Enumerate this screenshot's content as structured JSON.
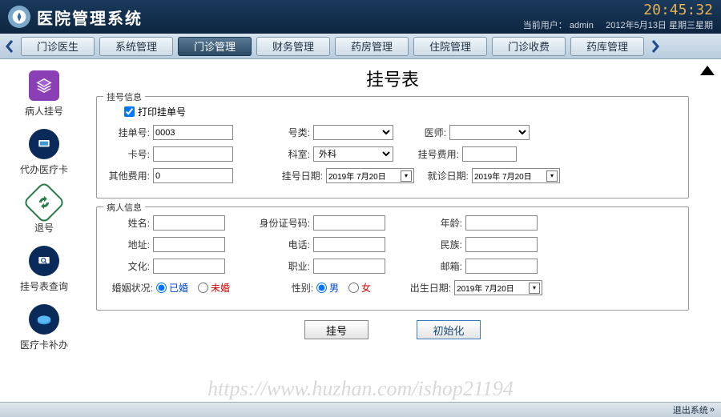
{
  "header": {
    "app_title": "医院管理系统",
    "clock": "20:45:32",
    "user_label": "当前用户：",
    "user_name": "admin",
    "date_text": "2012年5月13日  星期三星期"
  },
  "tabs": [
    {
      "label": "门诊医生",
      "active": false
    },
    {
      "label": "系统管理",
      "active": false
    },
    {
      "label": "门诊管理",
      "active": true
    },
    {
      "label": "财务管理",
      "active": false
    },
    {
      "label": "药房管理",
      "active": false
    },
    {
      "label": "住院管理",
      "active": false
    },
    {
      "label": "门诊收费",
      "active": false
    },
    {
      "label": "药库管理",
      "active": false
    }
  ],
  "sidebar": {
    "items": [
      {
        "label": "病人挂号",
        "icon": "layers-icon",
        "color": "#8a3fb5"
      },
      {
        "label": "代办医疗卡",
        "icon": "monitor-icon",
        "color": "#1a4a9a"
      },
      {
        "label": "退号",
        "icon": "refresh-icon",
        "color": "#2a7a4a"
      },
      {
        "label": "挂号表查询",
        "icon": "search-monitor-icon",
        "color": "#1a4a9a"
      },
      {
        "label": "医疗卡补办",
        "icon": "card-icon",
        "color": "#1a6aaa"
      }
    ]
  },
  "page": {
    "title": "挂号表"
  },
  "group1": {
    "title": "挂号信息",
    "print_chk": "打印挂单号",
    "reg_no_lbl": "挂单号:",
    "reg_no_val": "0003",
    "type_lbl": "号类:",
    "doctor_lbl": "医师:",
    "card_lbl": "卡号:",
    "dept_lbl": "科室:",
    "dept_val": "外科",
    "fee_lbl": "挂号费用:",
    "other_fee_lbl": "其他费用:",
    "other_fee_val": "0",
    "reg_date_lbl": "挂号日期:",
    "reg_date_val": "2019年 7月20日",
    "visit_date_lbl": "就诊日期:",
    "visit_date_val": "2019年 7月20日"
  },
  "group2": {
    "title": "病人信息",
    "name_lbl": "姓名:",
    "idcard_lbl": "身份证号码:",
    "age_lbl": "年龄:",
    "addr_lbl": "地址:",
    "phone_lbl": "电话:",
    "nation_lbl": "民族:",
    "edu_lbl": "文化:",
    "job_lbl": "职业:",
    "email_lbl": "邮箱:",
    "marital_lbl": "婚姻状况:",
    "married": "已婚",
    "unmarried": "未婚",
    "gender_lbl": "性别:",
    "male": "男",
    "female": "女",
    "birth_lbl": "出生日期:",
    "birth_val": "2019年 7月20日"
  },
  "buttons": {
    "register": "挂号",
    "init": "初始化"
  },
  "footer": {
    "exit": "退出系统"
  },
  "watermark": "https://www.huzhan.com/ishop21194"
}
